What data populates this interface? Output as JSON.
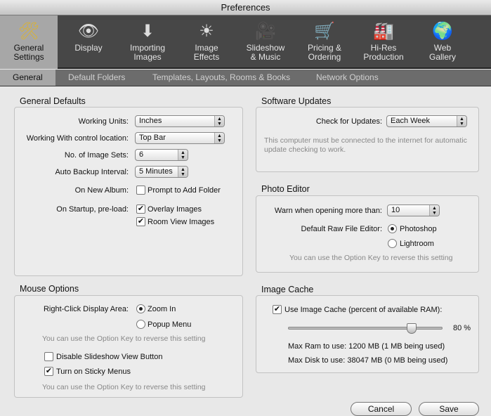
{
  "window": {
    "title": "Preferences"
  },
  "toolbar": [
    {
      "label1": "General",
      "label2": "Settings",
      "icon": "tools-icon",
      "glyph": "🛠"
    },
    {
      "label1": "Display",
      "label2": "",
      "icon": "eye-display-icon",
      "glyph": "👁"
    },
    {
      "label1": "Importing",
      "label2": "Images",
      "icon": "import-icon",
      "glyph": "⬇"
    },
    {
      "label1": "Image",
      "label2": "Effects",
      "icon": "person-light-icon",
      "glyph": "☀"
    },
    {
      "label1": "Slideshow",
      "label2": "& Music",
      "icon": "movie-camera-icon",
      "glyph": "🎥"
    },
    {
      "label1": "Pricing &",
      "label2": "Ordering",
      "icon": "cart-icon",
      "glyph": "🛒"
    },
    {
      "label1": "Hi-Res",
      "label2": "Production",
      "icon": "factory-icon",
      "glyph": "🏭"
    },
    {
      "label1": "Web",
      "label2": "Gallery",
      "icon": "globe-icon",
      "glyph": "🌍"
    }
  ],
  "subtabs": [
    "General",
    "Default Folders",
    "Templates, Layouts, Rooms & Books",
    "Network Options"
  ],
  "general_defaults": {
    "title": "General Defaults",
    "working_units_label": "Working Units:",
    "working_units": "Inches",
    "control_location_label": "Working With control location:",
    "control_location": "Top Bar",
    "image_sets_label": "No. of Image Sets:",
    "image_sets": "6",
    "backup_label": "Auto Backup Interval:",
    "backup": "5 Minutes",
    "new_album_label": "On New Album:",
    "prompt_folder": "Prompt to Add Folder",
    "startup_label": "On Startup, pre-load:",
    "overlay": "Overlay Images",
    "room_view": "Room View Images"
  },
  "mouse_options": {
    "title": "Mouse Options",
    "right_click_label": "Right-Click Display Area:",
    "zoom_in": "Zoom In",
    "popup_menu": "Popup Menu",
    "note1": "You can use the Option Key to reverse this setting",
    "disable_slideshow": "Disable Slideshow View Button",
    "sticky_menus": "Turn on Sticky Menus",
    "note2": "You can use the Option Key to reverse this setting"
  },
  "software_updates": {
    "title": "Software Updates",
    "check_label": "Check for Updates:",
    "check_value": "Each Week",
    "note": "This computer must be connected to the internet for automatic update checking to work."
  },
  "photo_editor": {
    "title": "Photo Editor",
    "warn_label": "Warn when opening more than:",
    "warn_value": "10",
    "raw_label": "Default Raw File Editor:",
    "photoshop": "Photoshop",
    "lightroom": "Lightroom",
    "note": "You can use the Option Key to reverse this setting"
  },
  "image_cache": {
    "title": "Image Cache",
    "use_cache": "Use Image Cache (percent of available RAM):",
    "percent": 80,
    "percent_label": "80 %",
    "max_ram": "Max Ram to use: 1200 MB  (1 MB being used)",
    "max_disk": "Max Disk to use: 38047 MB  (0 MB being used)"
  },
  "buttons": {
    "cancel": "Cancel",
    "save": "Save"
  }
}
